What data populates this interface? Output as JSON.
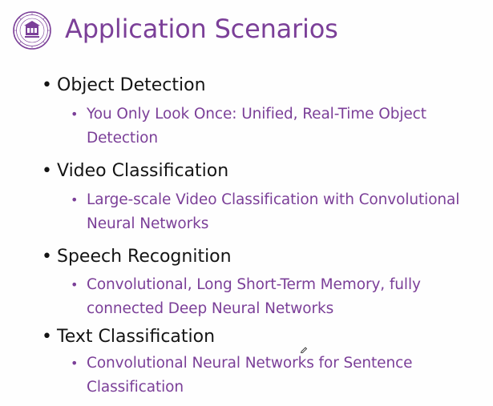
{
  "slide": {
    "title": "Application Scenarios",
    "accent_color": "#7b3f98",
    "items": [
      {
        "heading": "Object Detection",
        "sub": "You Only Look Once: Unified, Real-Time Object Detection"
      },
      {
        "heading": "Video Classification",
        "sub": "Large-scale Video Classification with Convolutional Neural Networks"
      },
      {
        "heading": "Speech Recognition",
        "sub": "Convolutional, Long Short-Term Memory, fully connected Deep Neural Networks"
      },
      {
        "heading": "Text Classification",
        "sub": "Convolutional Neural Networks for Sentence Classification"
      }
    ]
  },
  "logo": {
    "icon": "university-seal-icon"
  },
  "cursor": {
    "icon": "pen-cursor-icon"
  }
}
